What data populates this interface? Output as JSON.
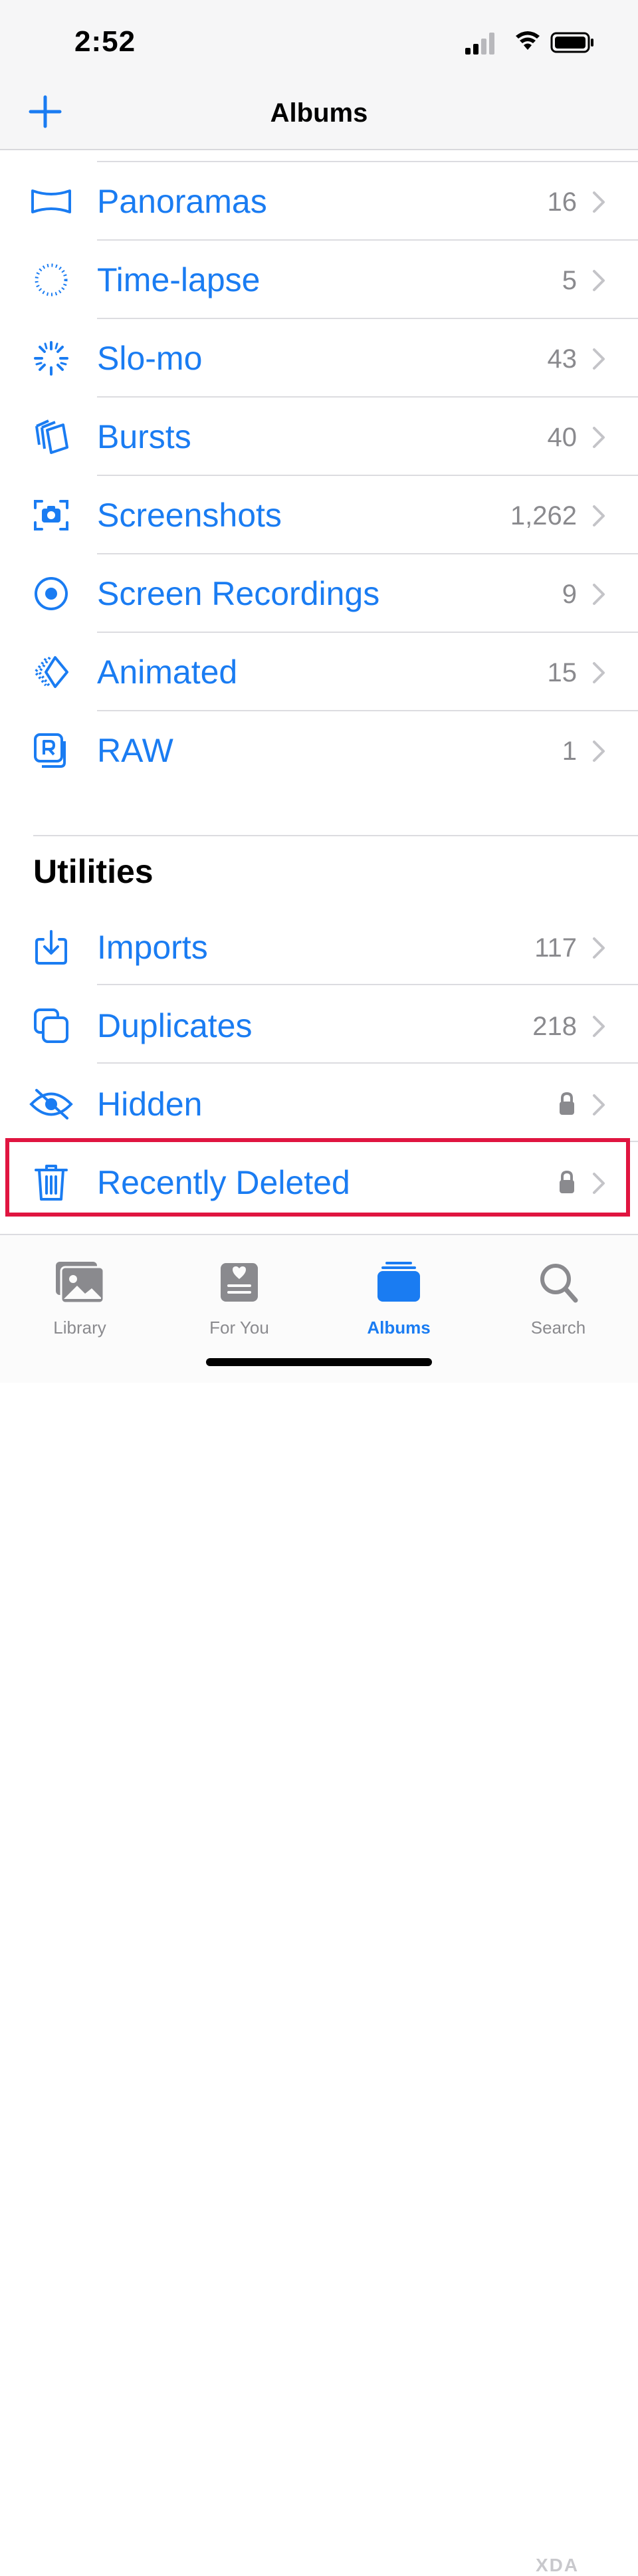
{
  "status_bar": {
    "time": "2:52"
  },
  "nav": {
    "title": "Albums",
    "add_icon": "plus-icon"
  },
  "media_types": [
    {
      "label": "Panoramas",
      "count": "16",
      "icon": "panorama-icon"
    },
    {
      "label": "Time-lapse",
      "count": "5",
      "icon": "timelapse-icon"
    },
    {
      "label": "Slo-mo",
      "count": "43",
      "icon": "slomo-icon"
    },
    {
      "label": "Bursts",
      "count": "40",
      "icon": "bursts-icon"
    },
    {
      "label": "Screenshots",
      "count": "1,262",
      "icon": "screenshot-icon"
    },
    {
      "label": "Screen Recordings",
      "count": "9",
      "icon": "screen-recording-icon"
    },
    {
      "label": "Animated",
      "count": "15",
      "icon": "animated-icon"
    },
    {
      "label": "RAW",
      "count": "1",
      "icon": "raw-icon"
    }
  ],
  "utilities": {
    "title": "Utilities",
    "items": [
      {
        "label": "Imports",
        "count": "117",
        "icon": "imports-icon"
      },
      {
        "label": "Duplicates",
        "count": "218",
        "icon": "duplicates-icon"
      },
      {
        "label": "Hidden",
        "locked": true,
        "icon": "hidden-eye-icon"
      },
      {
        "label": "Recently Deleted",
        "locked": true,
        "icon": "trash-icon",
        "highlighted": true
      }
    ]
  },
  "tabs": [
    {
      "label": "Library",
      "icon": "photos-icon",
      "active": false
    },
    {
      "label": "For You",
      "icon": "for-you-icon",
      "active": false
    },
    {
      "label": "Albums",
      "icon": "albums-icon",
      "active": true
    },
    {
      "label": "Search",
      "icon": "search-icon",
      "active": false
    }
  ],
  "watermark": "XDA",
  "colors": {
    "accent": "#1a7cf2",
    "highlight": "#e01540",
    "secondary_text": "#8a8a8e"
  }
}
